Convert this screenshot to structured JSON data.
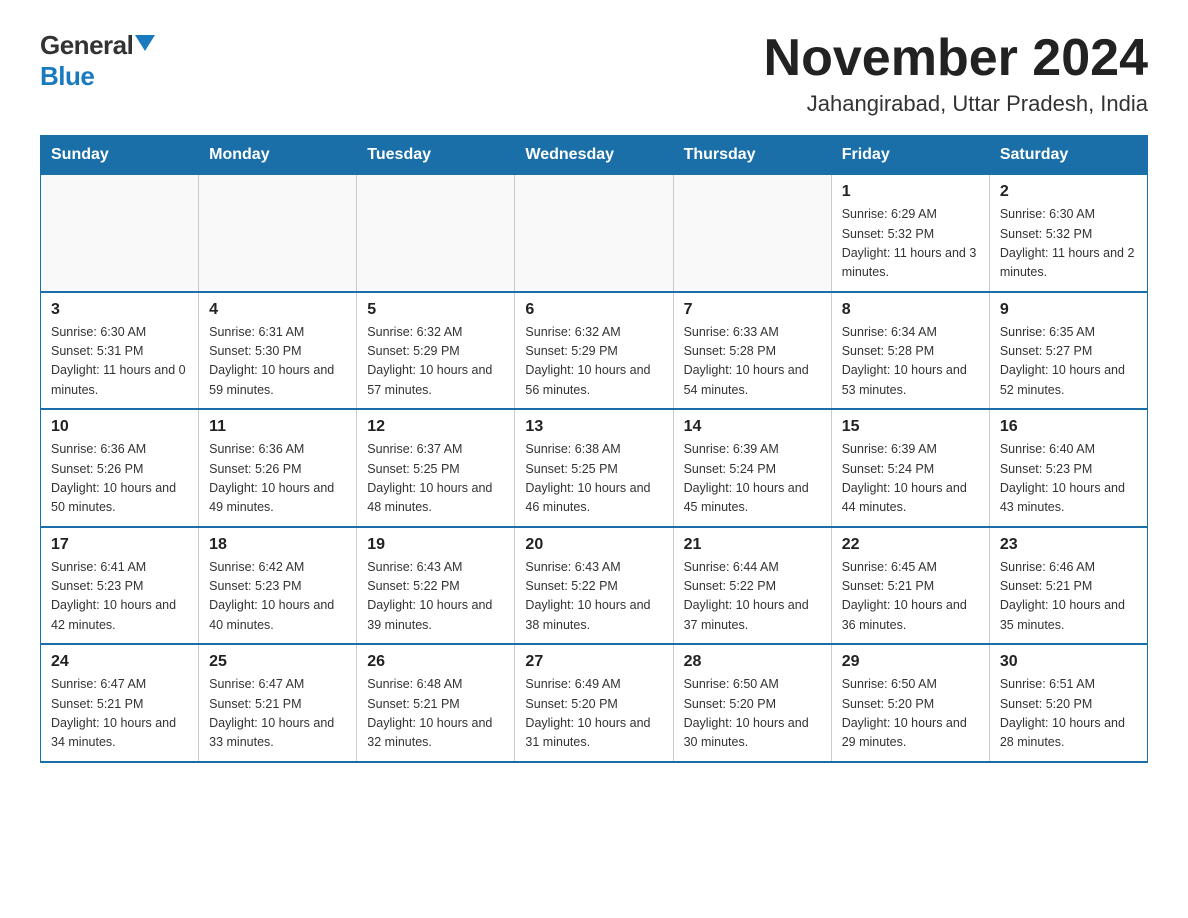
{
  "logo": {
    "general": "General",
    "blue": "Blue"
  },
  "title": "November 2024",
  "location": "Jahangirabad, Uttar Pradesh, India",
  "days_of_week": [
    "Sunday",
    "Monday",
    "Tuesday",
    "Wednesday",
    "Thursday",
    "Friday",
    "Saturday"
  ],
  "weeks": [
    [
      {
        "day": "",
        "info": ""
      },
      {
        "day": "",
        "info": ""
      },
      {
        "day": "",
        "info": ""
      },
      {
        "day": "",
        "info": ""
      },
      {
        "day": "",
        "info": ""
      },
      {
        "day": "1",
        "info": "Sunrise: 6:29 AM\nSunset: 5:32 PM\nDaylight: 11 hours and 3 minutes."
      },
      {
        "day": "2",
        "info": "Sunrise: 6:30 AM\nSunset: 5:32 PM\nDaylight: 11 hours and 2 minutes."
      }
    ],
    [
      {
        "day": "3",
        "info": "Sunrise: 6:30 AM\nSunset: 5:31 PM\nDaylight: 11 hours and 0 minutes."
      },
      {
        "day": "4",
        "info": "Sunrise: 6:31 AM\nSunset: 5:30 PM\nDaylight: 10 hours and 59 minutes."
      },
      {
        "day": "5",
        "info": "Sunrise: 6:32 AM\nSunset: 5:29 PM\nDaylight: 10 hours and 57 minutes."
      },
      {
        "day": "6",
        "info": "Sunrise: 6:32 AM\nSunset: 5:29 PM\nDaylight: 10 hours and 56 minutes."
      },
      {
        "day": "7",
        "info": "Sunrise: 6:33 AM\nSunset: 5:28 PM\nDaylight: 10 hours and 54 minutes."
      },
      {
        "day": "8",
        "info": "Sunrise: 6:34 AM\nSunset: 5:28 PM\nDaylight: 10 hours and 53 minutes."
      },
      {
        "day": "9",
        "info": "Sunrise: 6:35 AM\nSunset: 5:27 PM\nDaylight: 10 hours and 52 minutes."
      }
    ],
    [
      {
        "day": "10",
        "info": "Sunrise: 6:36 AM\nSunset: 5:26 PM\nDaylight: 10 hours and 50 minutes."
      },
      {
        "day": "11",
        "info": "Sunrise: 6:36 AM\nSunset: 5:26 PM\nDaylight: 10 hours and 49 minutes."
      },
      {
        "day": "12",
        "info": "Sunrise: 6:37 AM\nSunset: 5:25 PM\nDaylight: 10 hours and 48 minutes."
      },
      {
        "day": "13",
        "info": "Sunrise: 6:38 AM\nSunset: 5:25 PM\nDaylight: 10 hours and 46 minutes."
      },
      {
        "day": "14",
        "info": "Sunrise: 6:39 AM\nSunset: 5:24 PM\nDaylight: 10 hours and 45 minutes."
      },
      {
        "day": "15",
        "info": "Sunrise: 6:39 AM\nSunset: 5:24 PM\nDaylight: 10 hours and 44 minutes."
      },
      {
        "day": "16",
        "info": "Sunrise: 6:40 AM\nSunset: 5:23 PM\nDaylight: 10 hours and 43 minutes."
      }
    ],
    [
      {
        "day": "17",
        "info": "Sunrise: 6:41 AM\nSunset: 5:23 PM\nDaylight: 10 hours and 42 minutes."
      },
      {
        "day": "18",
        "info": "Sunrise: 6:42 AM\nSunset: 5:23 PM\nDaylight: 10 hours and 40 minutes."
      },
      {
        "day": "19",
        "info": "Sunrise: 6:43 AM\nSunset: 5:22 PM\nDaylight: 10 hours and 39 minutes."
      },
      {
        "day": "20",
        "info": "Sunrise: 6:43 AM\nSunset: 5:22 PM\nDaylight: 10 hours and 38 minutes."
      },
      {
        "day": "21",
        "info": "Sunrise: 6:44 AM\nSunset: 5:22 PM\nDaylight: 10 hours and 37 minutes."
      },
      {
        "day": "22",
        "info": "Sunrise: 6:45 AM\nSunset: 5:21 PM\nDaylight: 10 hours and 36 minutes."
      },
      {
        "day": "23",
        "info": "Sunrise: 6:46 AM\nSunset: 5:21 PM\nDaylight: 10 hours and 35 minutes."
      }
    ],
    [
      {
        "day": "24",
        "info": "Sunrise: 6:47 AM\nSunset: 5:21 PM\nDaylight: 10 hours and 34 minutes."
      },
      {
        "day": "25",
        "info": "Sunrise: 6:47 AM\nSunset: 5:21 PM\nDaylight: 10 hours and 33 minutes."
      },
      {
        "day": "26",
        "info": "Sunrise: 6:48 AM\nSunset: 5:21 PM\nDaylight: 10 hours and 32 minutes."
      },
      {
        "day": "27",
        "info": "Sunrise: 6:49 AM\nSunset: 5:20 PM\nDaylight: 10 hours and 31 minutes."
      },
      {
        "day": "28",
        "info": "Sunrise: 6:50 AM\nSunset: 5:20 PM\nDaylight: 10 hours and 30 minutes."
      },
      {
        "day": "29",
        "info": "Sunrise: 6:50 AM\nSunset: 5:20 PM\nDaylight: 10 hours and 29 minutes."
      },
      {
        "day": "30",
        "info": "Sunrise: 6:51 AM\nSunset: 5:20 PM\nDaylight: 10 hours and 28 minutes."
      }
    ]
  ]
}
